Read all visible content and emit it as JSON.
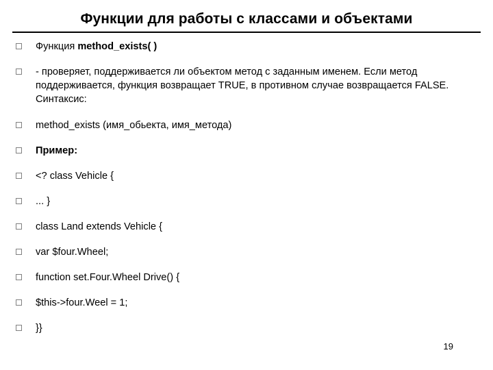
{
  "slide": {
    "title": "Функции для работы с классами и объектами",
    "page_number": "19",
    "bullets": [
      {
        "id": "bullet-function-heading",
        "prefix": "Функция ",
        "bold": "method_exists( )",
        "suffix": "",
        "style": "mixed"
      },
      {
        "id": "bullet-description",
        "text": "- проверяет, поддерживается ли объектом метод с заданным именем. Если метод поддерживается, функция возвращает TRUE, в противном случае возвращается FALSE. Синтаксис:",
        "style": "normal"
      },
      {
        "id": "bullet-syntax",
        "text": "method_exists (имя_обьекта, имя_метода)",
        "style": "normal"
      },
      {
        "id": "bullet-example-label",
        "text": "Пример:",
        "style": "bold"
      },
      {
        "id": "bullet-code-1",
        "text": "<?  class Vehicle {",
        "style": "normal"
      },
      {
        "id": "bullet-code-2",
        "text": "... }",
        "style": "normal"
      },
      {
        "id": "bullet-code-3",
        "text": "class Land extends Vehicle {",
        "style": "normal"
      },
      {
        "id": "bullet-code-4",
        "text": "var $four.Wheel;",
        "style": "normal"
      },
      {
        "id": "bullet-code-5",
        "text": "function set.Four.Wheel Drive() {",
        "style": "normal"
      },
      {
        "id": "bullet-code-6",
        "text": "$this->four.Weel = 1;",
        "style": "normal"
      },
      {
        "id": "bullet-code-7",
        "text": "}}",
        "style": "normal"
      }
    ]
  }
}
